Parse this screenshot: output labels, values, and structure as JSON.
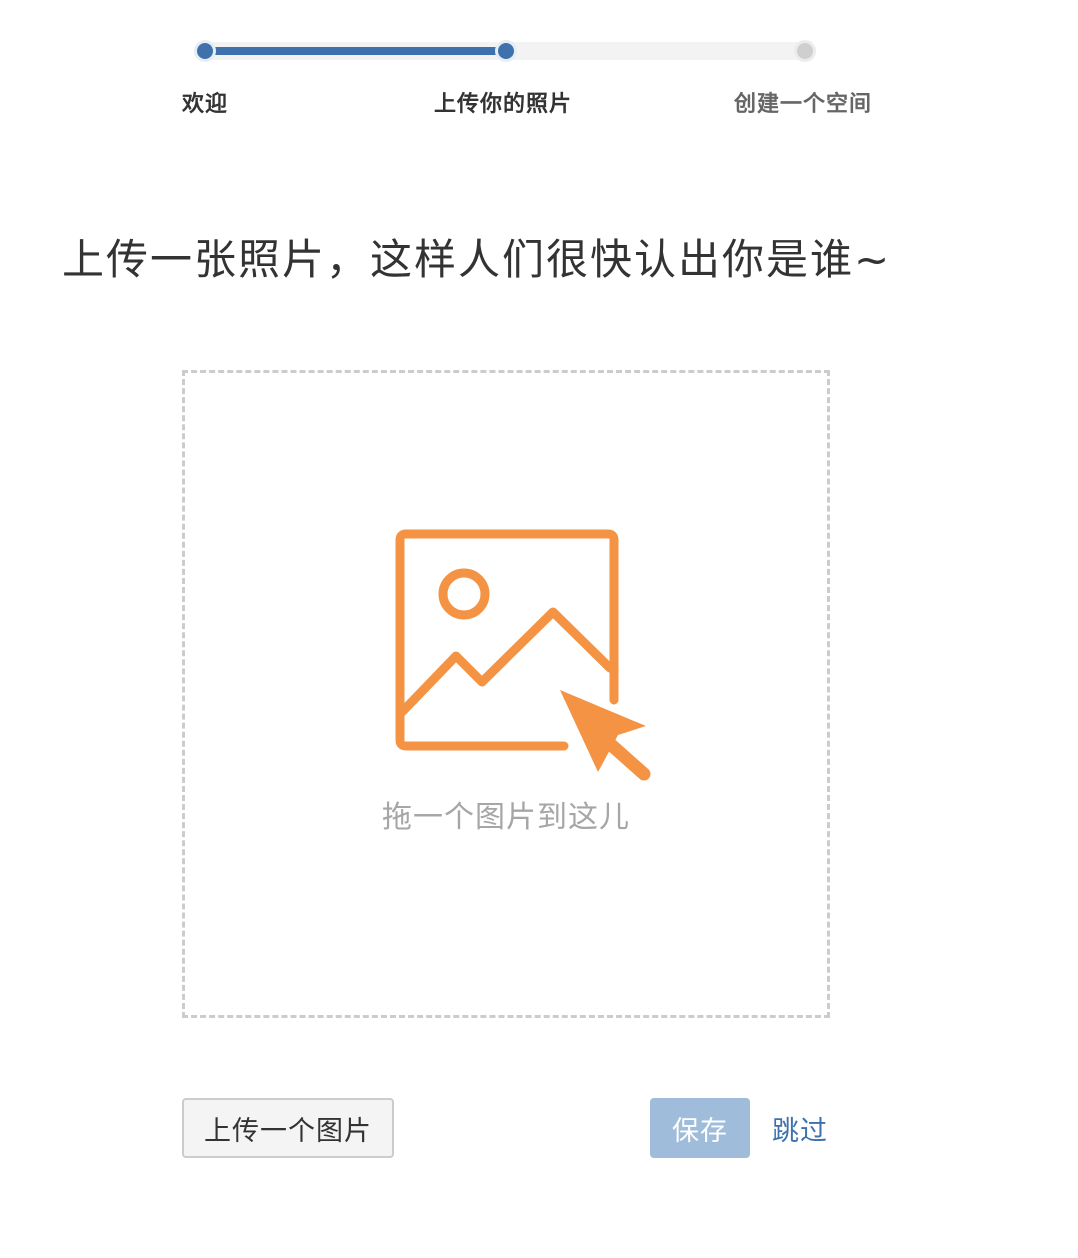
{
  "stepper": {
    "progress": 0.5,
    "current_step": 2,
    "steps": [
      {
        "label": "欢迎",
        "state": "done"
      },
      {
        "label": "上传你的照片",
        "state": "current"
      },
      {
        "label": "创建一个空间",
        "state": "todo"
      }
    ]
  },
  "heading": {
    "title": "上传一张照片，这样人们很快认出你是谁~"
  },
  "dropzone": {
    "icon": "image-upload-icon",
    "hint": "拖一个图片到这儿"
  },
  "actions": {
    "upload_label": "上传一个图片",
    "save_label": "保存",
    "save_disabled": true,
    "skip_label": "跳过"
  },
  "colors": {
    "accent": "#3f72ad",
    "accent_disabled": "#9fbcda",
    "icon_orange": "#f39343",
    "track": "#f3f3f3",
    "dashed_border": "#cccccc",
    "hint_text": "#a6a6a6"
  }
}
